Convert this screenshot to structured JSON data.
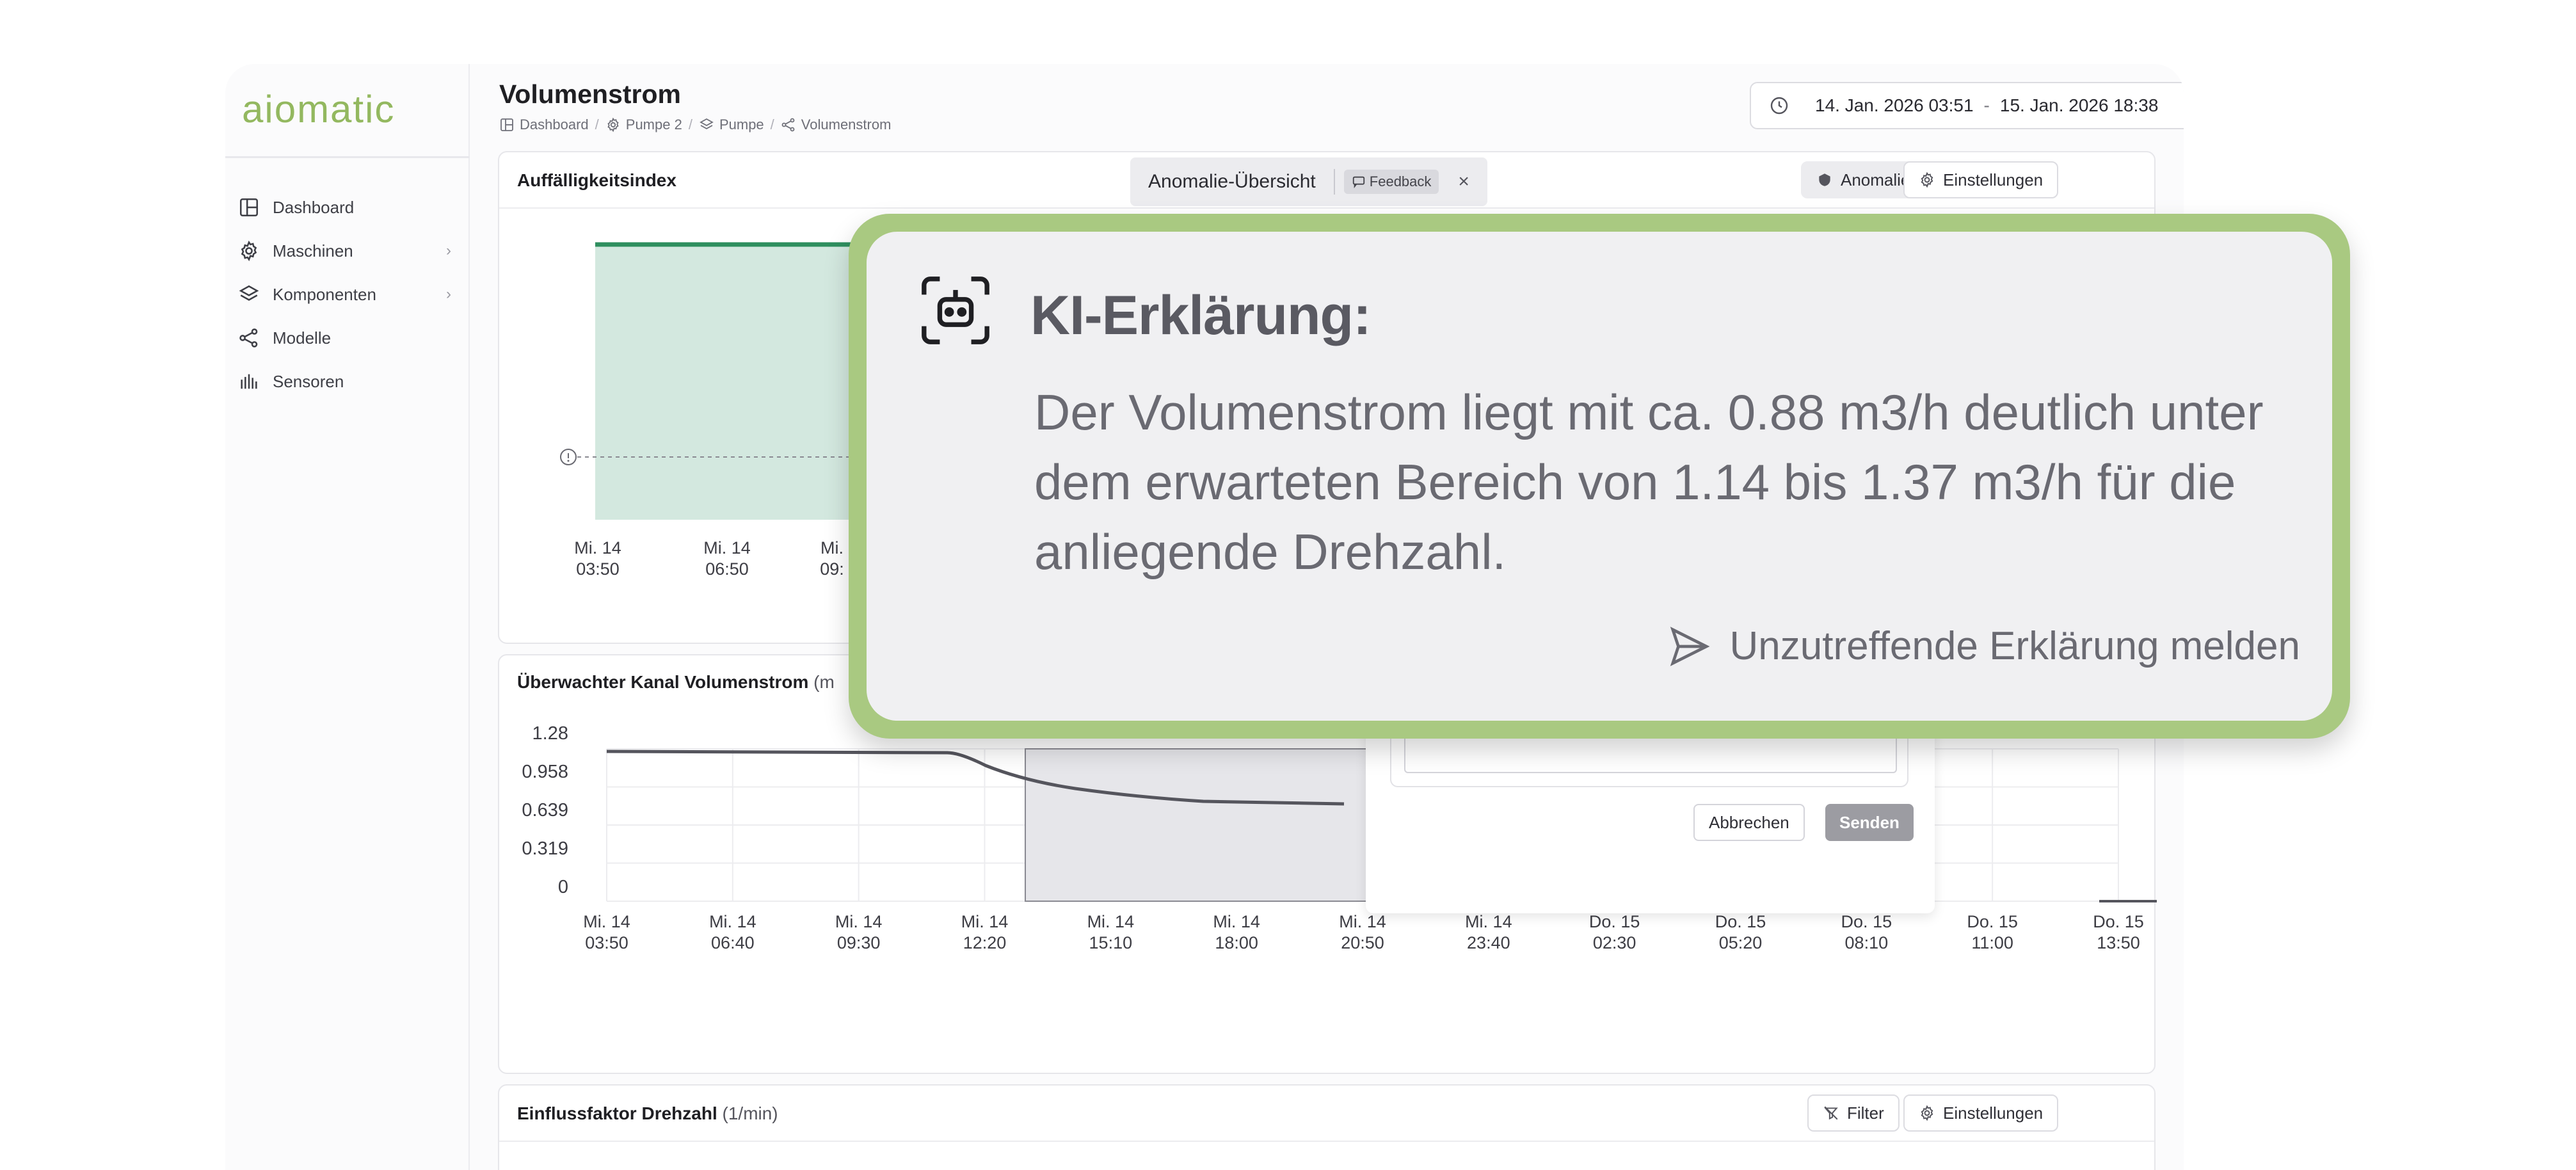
{
  "app": {
    "logo": "aiomatic"
  },
  "sidebar": {
    "items": [
      {
        "label": "Dashboard",
        "icon": "layout-icon"
      },
      {
        "label": "Maschinen",
        "icon": "gear-icon",
        "chevron": "›"
      },
      {
        "label": "Komponenten",
        "icon": "layers-icon",
        "chevron": "›"
      },
      {
        "label": "Modelle",
        "icon": "share-nodes-icon"
      },
      {
        "label": "Sensoren",
        "icon": "bar-chart-icon"
      }
    ]
  },
  "header": {
    "title": "Volumenstrom",
    "breadcrumb": [
      "Dashboard",
      "Pumpe 2",
      "Pumpe",
      "Volumenstrom"
    ],
    "separator": "/",
    "date_from": "14. Jan. 2026 03:51",
    "date_sep": "-",
    "date_to": "15. Jan. 2026 18:38"
  },
  "card_anomaly": {
    "title": "Auffälligkeitsindex",
    "tab_label": "Anomalie-Übersicht",
    "feedback_label": "Feedback",
    "close": "×",
    "rule_button": "Anomalieregel",
    "settings_button": "Einstellungen",
    "x_ticks_visible": [
      [
        "Mi. 14",
        "03:50"
      ],
      [
        "Mi. 14",
        "06:50"
      ],
      [
        "Mi.",
        "09:"
      ]
    ],
    "marker_icon": "info-circle-icon"
  },
  "card_channel": {
    "title": "Überwachter Kanal Volumenstrom",
    "title_unit": "(m",
    "y_ticks": [
      "1.28",
      "0.958",
      "0.639",
      "0.319",
      "0"
    ],
    "x_ticks": [
      [
        "Mi. 14",
        "03:50"
      ],
      [
        "Mi. 14",
        "06:40"
      ],
      [
        "Mi. 14",
        "09:30"
      ],
      [
        "Mi. 14",
        "12:20"
      ],
      [
        "Mi. 14",
        "15:10"
      ],
      [
        "Mi. 14",
        "18:00"
      ],
      [
        "Mi. 14",
        "20:50"
      ],
      [
        "Mi. 14",
        "23:40"
      ],
      [
        "Do. 15",
        "02:30"
      ],
      [
        "Do. 15",
        "05:20"
      ],
      [
        "Do. 15",
        "08:10"
      ],
      [
        "Do. 15",
        "11:00"
      ],
      [
        "Do. 15",
        "13:50"
      ]
    ]
  },
  "card_influence": {
    "title": "Einflussfaktor Drehzahl",
    "title_unit": "(1/min)",
    "filter_button": "Filter",
    "settings_button": "Einstellungen"
  },
  "feedback_popup": {
    "cancel": "Abbrechen",
    "send": "Senden"
  },
  "ai_overlay": {
    "title": "KI-Erklärung:",
    "body": "Der Volumenstrom liegt mit ca. 0.88 m3/h deutlich unter dem erwarteten Bereich von 1.14 bis 1.37 m3/h für die anliegende Drehzahl.",
    "report_label": "Unzutreffende Erklärung melden",
    "accent": "#a9c981"
  },
  "colors": {
    "brand": "#93b85f",
    "anomaly_fill": "#d3e8df",
    "anomaly_line": "#2f8f5f"
  }
}
